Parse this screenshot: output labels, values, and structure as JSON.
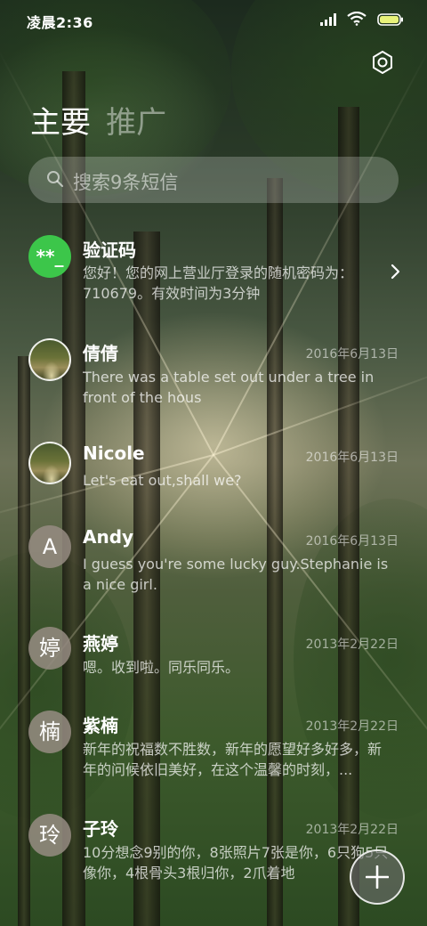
{
  "status_bar": {
    "time": "凌晨2:36"
  },
  "header": {
    "settings_icon": "gear-icon",
    "tabs": [
      {
        "label": "主要",
        "active": true
      },
      {
        "label": "推广",
        "active": false
      }
    ]
  },
  "search": {
    "placeholder": "搜索9条短信"
  },
  "conversations": [
    {
      "avatar_text": "**_",
      "avatar_type": "code",
      "name": "验证码",
      "date": "",
      "preview": "您好！您的网上营业厅登录的随机密码为：710679。有效时间为3分钟",
      "has_chevron": true
    },
    {
      "avatar_text": "",
      "avatar_type": "photo",
      "name": "倩倩",
      "date": "2016年6月13日",
      "preview": "There was a table set out under a tree in front of the hous"
    },
    {
      "avatar_text": "",
      "avatar_type": "photo",
      "name": "Nicole",
      "date": "2016年6月13日",
      "preview": "Let's eat out,shall we?"
    },
    {
      "avatar_text": "A",
      "avatar_type": "letter",
      "name": "Andy",
      "date": "2016年6月13日",
      "preview": "I guess you're some lucky guy.Stephanie is a nice girl."
    },
    {
      "avatar_text": "婷",
      "avatar_type": "letter",
      "name": "燕婷",
      "date": "2013年2月22日",
      "preview": "嗯。收到啦。同乐同乐。"
    },
    {
      "avatar_text": "楠",
      "avatar_type": "letter",
      "name": "紫楠",
      "date": "2013年2月22日",
      "preview": "新年的祝福数不胜数，新年的愿望好多好多，新年的问候依旧美好，在这个温馨的时刻，..."
    },
    {
      "avatar_text": "玲",
      "avatar_type": "letter",
      "name": "子玲",
      "date": "2013年2月22日",
      "preview": "10分想念9别的你，8张照片7张是你，6只狗5只像你，4根骨头3根归你，2爪着地"
    }
  ],
  "fab": {
    "icon": "plus-icon"
  }
}
